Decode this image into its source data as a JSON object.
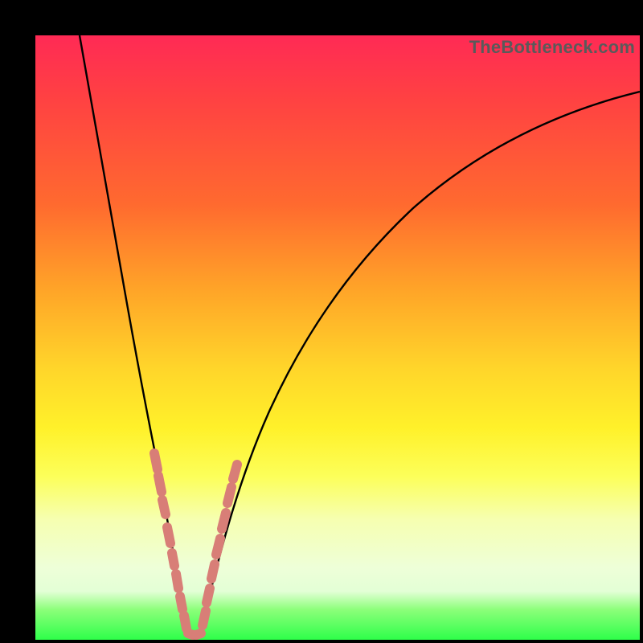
{
  "watermark": "TheBottleneck.com",
  "colors": {
    "background": "#000000",
    "gradient_stops": [
      "#ff2a55",
      "#ff4043",
      "#ff6a2f",
      "#ffa428",
      "#ffd52a",
      "#fff12a",
      "#fcff5a",
      "#f6ffb0",
      "#eeffd8",
      "#e3ffd6",
      "#8cff7a",
      "#2eff4a"
    ],
    "curve": "#000000",
    "marker": "#e38a82"
  },
  "chart_data": {
    "type": "line",
    "title": "",
    "xlabel": "",
    "ylabel": "",
    "xlim": [
      0,
      100
    ],
    "ylim": [
      0,
      100
    ],
    "note": "Two black curves descending into a V-shaped minimum near x≈25; left branch from top-left, right branch rising toward upper-right. Pink rounded markers highlight the region around the minimum on both branches.",
    "series": [
      {
        "name": "left-branch",
        "x": [
          7,
          9,
          11,
          13,
          15,
          17,
          19,
          20,
          21,
          22,
          23,
          24,
          25
        ],
        "y": [
          100,
          90,
          78,
          66,
          55,
          43,
          33,
          27,
          22,
          17,
          11,
          5,
          1
        ]
      },
      {
        "name": "right-branch",
        "x": [
          25,
          27,
          29,
          31,
          33,
          36,
          40,
          45,
          50,
          56,
          63,
          72,
          82,
          92,
          100
        ],
        "y": [
          1,
          6,
          12,
          19,
          26,
          34,
          43,
          52,
          59,
          66,
          72,
          79,
          84,
          88,
          91
        ]
      }
    ],
    "markers": [
      {
        "x": 19.5,
        "y": 30
      },
      {
        "x": 20.2,
        "y": 26
      },
      {
        "x": 20.9,
        "y": 22
      },
      {
        "x": 21.9,
        "y": 16
      },
      {
        "x": 22.7,
        "y": 12
      },
      {
        "x": 23.3,
        "y": 9
      },
      {
        "x": 23.8,
        "y": 6
      },
      {
        "x": 24.5,
        "y": 2.5
      },
      {
        "x": 25.3,
        "y": 1.2
      },
      {
        "x": 26.4,
        "y": 1.2
      },
      {
        "x": 27.3,
        "y": 1.5
      },
      {
        "x": 27.6,
        "y": 7
      },
      {
        "x": 28.3,
        "y": 11
      },
      {
        "x": 29.2,
        "y": 15
      },
      {
        "x": 29.8,
        "y": 19
      },
      {
        "x": 30.7,
        "y": 23
      },
      {
        "x": 31.6,
        "y": 27
      }
    ]
  }
}
